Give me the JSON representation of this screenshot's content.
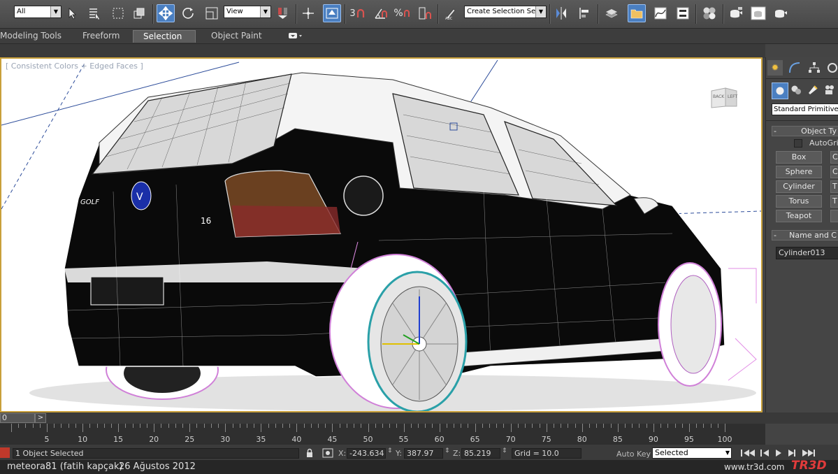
{
  "toolbar": {
    "selection_filter": "All",
    "ref_coord": "View",
    "snap_label": "3",
    "named_selection_placeholder": "Create Selection Se",
    "icons": [
      "select-object-icon",
      "select-by-name-icon",
      "rect-region-icon",
      "window-crossing-icon",
      "select-move-icon",
      "select-rotate-icon",
      "mirror-icon",
      "pivot-icon",
      "snaps-icon",
      "angle-snap-icon",
      "percent-snap-icon",
      "spinner-snap-icon",
      "edit-named-sets-icon",
      "mirror-tool-icon",
      "align-icon",
      "layer-manager-icon",
      "graphite-tools-icon",
      "curve-editor-icon",
      "schematic-view-icon",
      "material-editor-icon",
      "render-setup-icon",
      "rendered-frame-icon",
      "render-icon"
    ]
  },
  "ribbon": {
    "tabs": [
      "Modeling Tools",
      "Freeform",
      "Selection",
      "Object Paint"
    ],
    "selected": "Selection"
  },
  "viewport": {
    "label": "[ Consistent Colors + Edged Faces ]",
    "viewcube_back": "BACK",
    "viewcube_left": "LEFT",
    "plate_text": "16",
    "badge_text": "GOLF"
  },
  "command_panel": {
    "primitive_type": "Standard Primitives",
    "object_type_title": "Object Ty",
    "autogrid_label": "AutoGrid",
    "buttons": [
      "Box",
      "Sphere",
      "Cylinder",
      "Torus",
      "Teapot"
    ],
    "buttons_right": [
      "C",
      "C",
      "T",
      "T",
      ""
    ],
    "name_color_title": "Name and C",
    "object_name": "Cylinder013"
  },
  "timeline": {
    "frame_field": "0",
    "ticks": [
      5,
      10,
      15,
      20,
      25,
      30,
      35,
      40,
      45,
      50,
      55,
      60,
      65,
      70,
      75,
      80,
      85,
      90,
      95,
      100
    ]
  },
  "status": {
    "selection": "1 Object Selected",
    "x_label": "X:",
    "x_value": "-243.634",
    "y_label": "Y:",
    "y_value": "387.97",
    "z_label": "Z:",
    "z_value": "85.219",
    "grid": "Grid = 10.0",
    "auto_key": "Auto Key",
    "key_filter": "Selected"
  },
  "credit": {
    "author": "meteora81 (fatih kapçak)",
    "date": "26 Ağustos 2012",
    "site": "www.tr3d.com",
    "logo": "TR3D"
  },
  "colors": {
    "accent": "#4a7fc1",
    "viewport_border": "#c9a03a",
    "wire_pink": "#e28de6"
  }
}
